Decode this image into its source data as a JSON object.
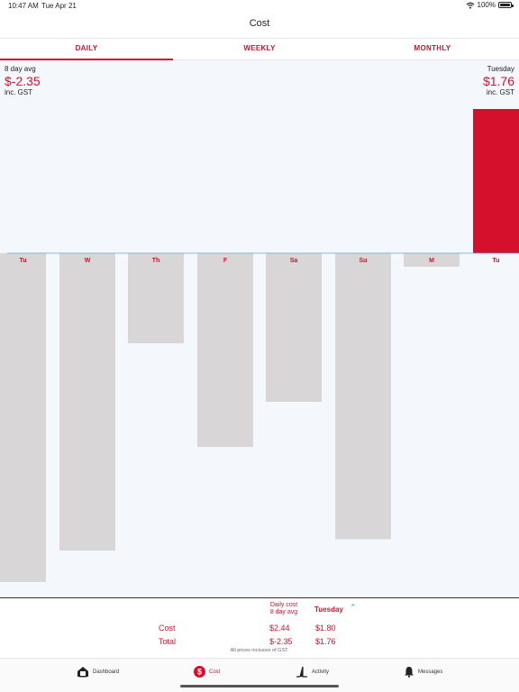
{
  "status_bar": {
    "time": "10:47 AM",
    "date": "Tue Apr 21",
    "battery": "100%"
  },
  "nav": {
    "title": "Cost"
  },
  "tabs": [
    {
      "label": "DAILY",
      "active": true
    },
    {
      "label": "WEEKLY",
      "active": false
    },
    {
      "label": "MONTHLY",
      "active": false
    }
  ],
  "summary_top": {
    "avg_label": "8 day avg",
    "avg_value": "$-2.35",
    "avg_sub": "inc. GST",
    "sel_label": "Tuesday",
    "sel_value": "$1.76",
    "sel_sub": "inc. GST"
  },
  "chart_data": {
    "type": "bar",
    "categories": [
      "Tu",
      "W",
      "Th",
      "F",
      "Sa",
      "Su",
      "M",
      "Tu"
    ],
    "values": [
      -7.3,
      -6.6,
      -2.0,
      -4.3,
      -3.3,
      -6.35,
      -0.3,
      3.2
    ],
    "selected_index": 7,
    "ylim": [
      -7.5,
      3.5
    ],
    "colors": {
      "positive": "#d5102c",
      "negative": "#d8d6d6",
      "baseline": "#6aa7c8",
      "label": "#d5102c"
    }
  },
  "breakdown": {
    "header_daily": "Daily cost",
    "header_avg": "8 day avg",
    "header_day": "Tuesday",
    "rows": [
      {
        "label": "Cost",
        "avg": "$2.44",
        "day": "$1.80"
      },
      {
        "label": "Total",
        "avg": "$-2.35",
        "day": "$1.76"
      }
    ],
    "footnote": "All prices inclusive of GST."
  },
  "tabbar": [
    {
      "label": "Dashboard",
      "icon": "house-icon",
      "active": false
    },
    {
      "label": "Cost",
      "icon": "dollar-icon",
      "active": true
    },
    {
      "label": "Activity",
      "icon": "activity-icon",
      "active": false
    },
    {
      "label": "Messages",
      "icon": "bell-icon",
      "active": false
    }
  ],
  "accent": "#d5102c"
}
